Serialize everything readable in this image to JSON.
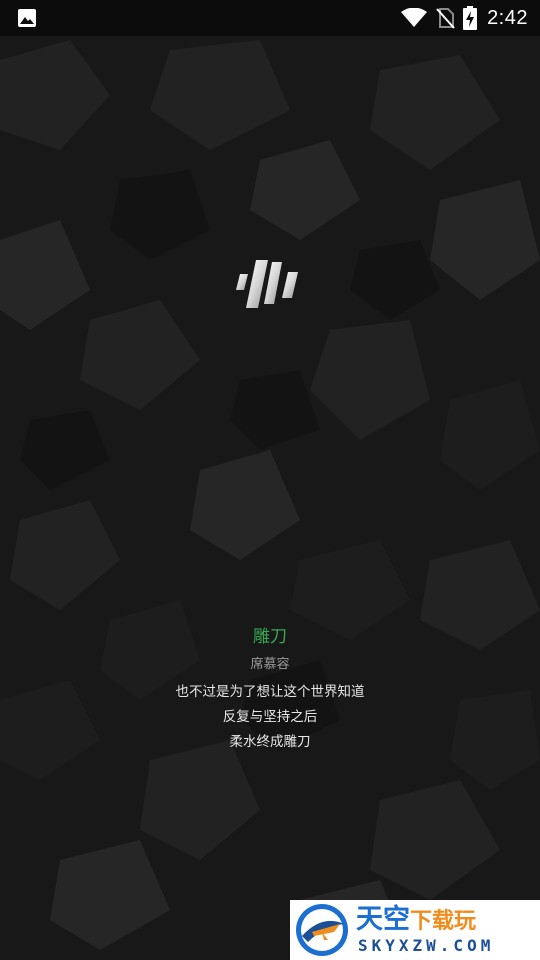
{
  "status_bar": {
    "time": "2:42",
    "icons": [
      "image-notification-icon",
      "wifi-icon",
      "no-sim-icon",
      "battery-charging-icon"
    ]
  },
  "song": {
    "title": "雕刀",
    "artist": "席慕容",
    "lines": [
      "也不过是为了想让这个世界知道",
      "反复与坚持之后",
      "柔水终成雕刀"
    ]
  },
  "watermark": {
    "brand_main": "天空",
    "brand_sub": "下载玩",
    "domain": "SKYXZW.COM"
  },
  "colors": {
    "title": "#36a852",
    "background": "#171717",
    "brand_blue": "#1c6fd0",
    "brand_orange": "#f08c1c"
  }
}
